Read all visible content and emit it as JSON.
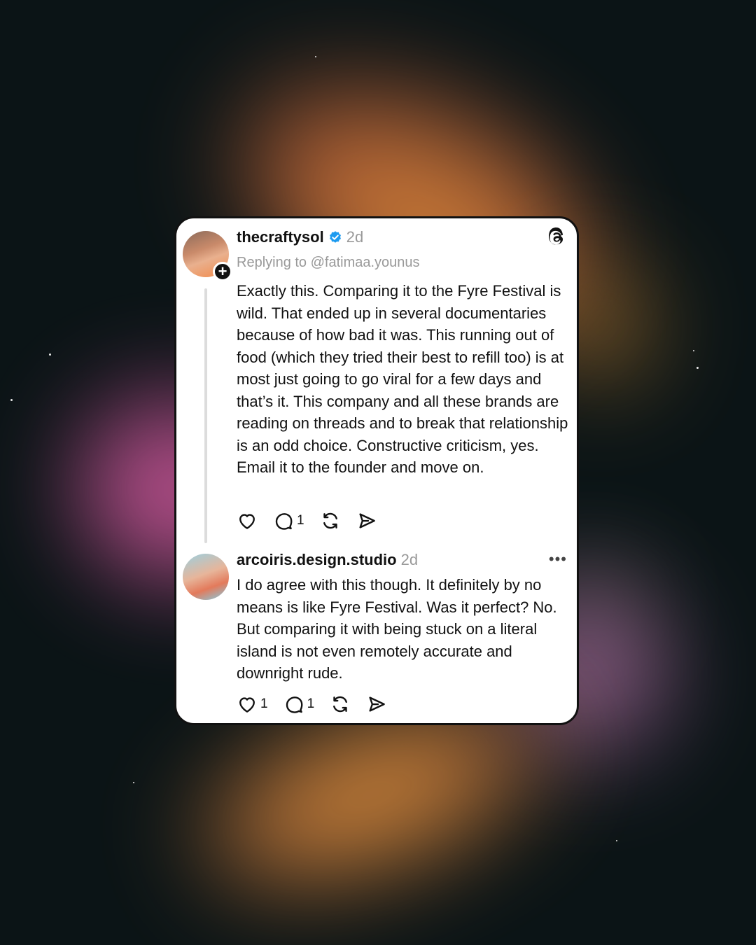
{
  "post": {
    "username": "thecraftysol",
    "time": "2d",
    "reply_to": "Replying to @fatimaa.younus",
    "text": "Exactly this. Comparing it to the Fyre Festival is wild. That ended up in several documentaries because of how bad it was. This running out of food (which they tried their best to refill too) is at most just going to go viral for a few days and that’s it. This company and all these brands are reading on threads and to break that relationship is an odd choice. Constructive criticism, yes. Email it to the founder and move on.",
    "comments": "1",
    "follow_icon": "plus-icon"
  },
  "reply": {
    "username": "arcoiris.design.studio",
    "time": "2d",
    "text": "I do agree with this though. It definitely by no means is like Fyre Festival. Was it perfect? No. But comparing it with being stuck on a literal island is not even remotely accurate and downright rude.",
    "likes": "1",
    "comments": "1",
    "more_label": "•••"
  },
  "icons": [
    "heart-icon",
    "comment-icon",
    "repost-icon",
    "share-icon",
    "threads-logo-icon",
    "verified-badge-icon"
  ],
  "colors": {
    "verified": "#1d9bf0",
    "text": "#111111",
    "muted": "#999999",
    "card_border": "#111111"
  }
}
